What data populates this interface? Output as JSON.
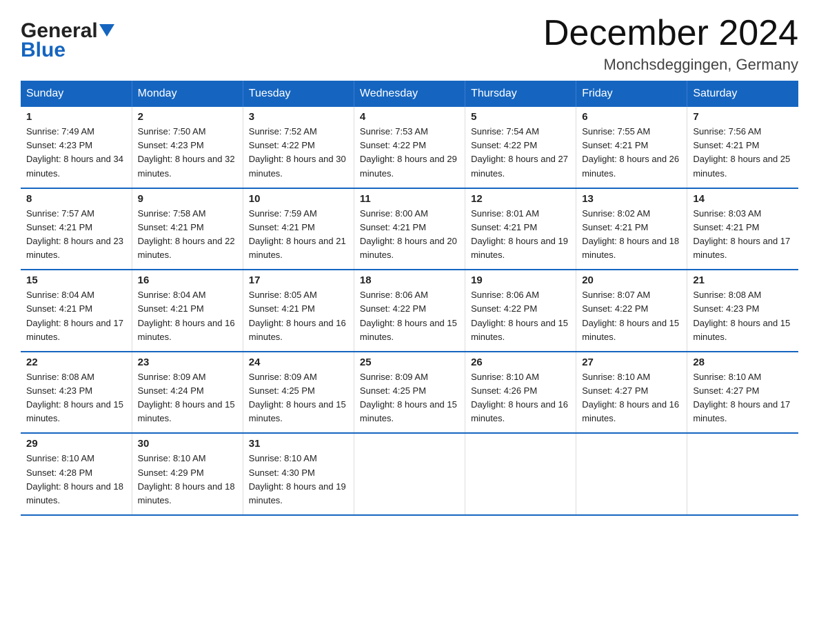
{
  "logo": {
    "general": "General",
    "blue": "Blue",
    "arrow_color": "#1565c0"
  },
  "title": "December 2024",
  "location": "Monchsdeggingen, Germany",
  "header_color": "#1565c0",
  "days_of_week": [
    "Sunday",
    "Monday",
    "Tuesday",
    "Wednesday",
    "Thursday",
    "Friday",
    "Saturday"
  ],
  "weeks": [
    [
      {
        "day": "1",
        "sunrise": "7:49 AM",
        "sunset": "4:23 PM",
        "daylight": "8 hours and 34 minutes."
      },
      {
        "day": "2",
        "sunrise": "7:50 AM",
        "sunset": "4:23 PM",
        "daylight": "8 hours and 32 minutes."
      },
      {
        "day": "3",
        "sunrise": "7:52 AM",
        "sunset": "4:22 PM",
        "daylight": "8 hours and 30 minutes."
      },
      {
        "day": "4",
        "sunrise": "7:53 AM",
        "sunset": "4:22 PM",
        "daylight": "8 hours and 29 minutes."
      },
      {
        "day": "5",
        "sunrise": "7:54 AM",
        "sunset": "4:22 PM",
        "daylight": "8 hours and 27 minutes."
      },
      {
        "day": "6",
        "sunrise": "7:55 AM",
        "sunset": "4:21 PM",
        "daylight": "8 hours and 26 minutes."
      },
      {
        "day": "7",
        "sunrise": "7:56 AM",
        "sunset": "4:21 PM",
        "daylight": "8 hours and 25 minutes."
      }
    ],
    [
      {
        "day": "8",
        "sunrise": "7:57 AM",
        "sunset": "4:21 PM",
        "daylight": "8 hours and 23 minutes."
      },
      {
        "day": "9",
        "sunrise": "7:58 AM",
        "sunset": "4:21 PM",
        "daylight": "8 hours and 22 minutes."
      },
      {
        "day": "10",
        "sunrise": "7:59 AM",
        "sunset": "4:21 PM",
        "daylight": "8 hours and 21 minutes."
      },
      {
        "day": "11",
        "sunrise": "8:00 AM",
        "sunset": "4:21 PM",
        "daylight": "8 hours and 20 minutes."
      },
      {
        "day": "12",
        "sunrise": "8:01 AM",
        "sunset": "4:21 PM",
        "daylight": "8 hours and 19 minutes."
      },
      {
        "day": "13",
        "sunrise": "8:02 AM",
        "sunset": "4:21 PM",
        "daylight": "8 hours and 18 minutes."
      },
      {
        "day": "14",
        "sunrise": "8:03 AM",
        "sunset": "4:21 PM",
        "daylight": "8 hours and 17 minutes."
      }
    ],
    [
      {
        "day": "15",
        "sunrise": "8:04 AM",
        "sunset": "4:21 PM",
        "daylight": "8 hours and 17 minutes."
      },
      {
        "day": "16",
        "sunrise": "8:04 AM",
        "sunset": "4:21 PM",
        "daylight": "8 hours and 16 minutes."
      },
      {
        "day": "17",
        "sunrise": "8:05 AM",
        "sunset": "4:21 PM",
        "daylight": "8 hours and 16 minutes."
      },
      {
        "day": "18",
        "sunrise": "8:06 AM",
        "sunset": "4:22 PM",
        "daylight": "8 hours and 15 minutes."
      },
      {
        "day": "19",
        "sunrise": "8:06 AM",
        "sunset": "4:22 PM",
        "daylight": "8 hours and 15 minutes."
      },
      {
        "day": "20",
        "sunrise": "8:07 AM",
        "sunset": "4:22 PM",
        "daylight": "8 hours and 15 minutes."
      },
      {
        "day": "21",
        "sunrise": "8:08 AM",
        "sunset": "4:23 PM",
        "daylight": "8 hours and 15 minutes."
      }
    ],
    [
      {
        "day": "22",
        "sunrise": "8:08 AM",
        "sunset": "4:23 PM",
        "daylight": "8 hours and 15 minutes."
      },
      {
        "day": "23",
        "sunrise": "8:09 AM",
        "sunset": "4:24 PM",
        "daylight": "8 hours and 15 minutes."
      },
      {
        "day": "24",
        "sunrise": "8:09 AM",
        "sunset": "4:25 PM",
        "daylight": "8 hours and 15 minutes."
      },
      {
        "day": "25",
        "sunrise": "8:09 AM",
        "sunset": "4:25 PM",
        "daylight": "8 hours and 15 minutes."
      },
      {
        "day": "26",
        "sunrise": "8:10 AM",
        "sunset": "4:26 PM",
        "daylight": "8 hours and 16 minutes."
      },
      {
        "day": "27",
        "sunrise": "8:10 AM",
        "sunset": "4:27 PM",
        "daylight": "8 hours and 16 minutes."
      },
      {
        "day": "28",
        "sunrise": "8:10 AM",
        "sunset": "4:27 PM",
        "daylight": "8 hours and 17 minutes."
      }
    ],
    [
      {
        "day": "29",
        "sunrise": "8:10 AM",
        "sunset": "4:28 PM",
        "daylight": "8 hours and 18 minutes."
      },
      {
        "day": "30",
        "sunrise": "8:10 AM",
        "sunset": "4:29 PM",
        "daylight": "8 hours and 18 minutes."
      },
      {
        "day": "31",
        "sunrise": "8:10 AM",
        "sunset": "4:30 PM",
        "daylight": "8 hours and 19 minutes."
      },
      null,
      null,
      null,
      null
    ]
  ]
}
